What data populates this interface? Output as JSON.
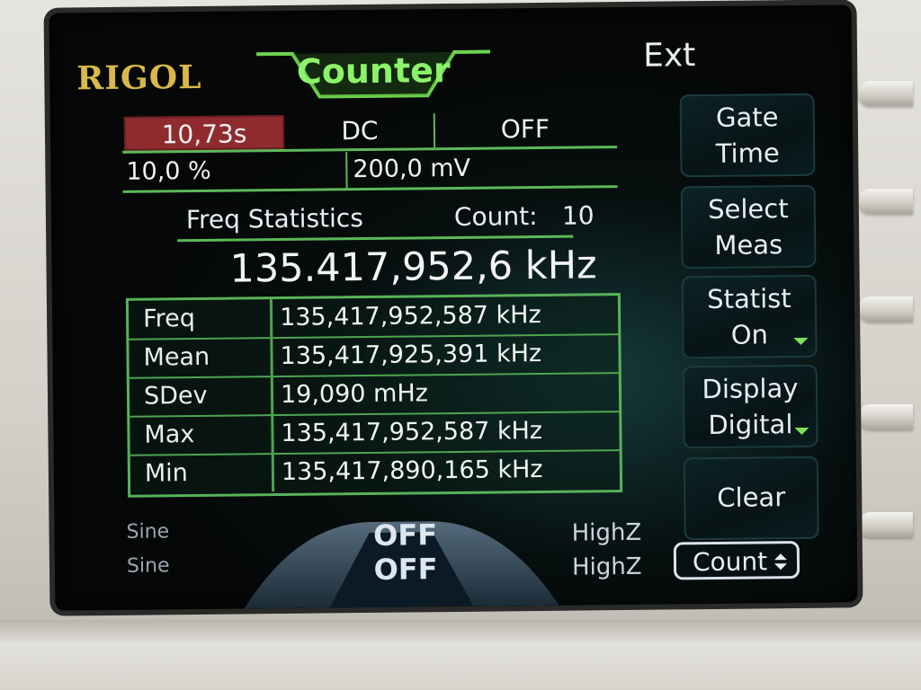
{
  "header": {
    "brand": "RIGOL",
    "title": "Counter",
    "trigger_source": "Ext"
  },
  "settings": {
    "gate_time": "10,73s",
    "coupling": "DC",
    "hf_filter": "OFF",
    "sensitivity": "10,0 %",
    "trigger_level": "200,0 mV"
  },
  "statistics": {
    "title": "Freq Statistics",
    "count_label": "Count:",
    "count_value": "10",
    "main_reading": "135.417,952,6 kHz",
    "rows": [
      {
        "name": "Freq",
        "value": "135,417,952,587 kHz"
      },
      {
        "name": "Mean",
        "value": "135,417,925,391 kHz"
      },
      {
        "name": "SDev",
        "value": "19,090 mHz"
      },
      {
        "name": "Max",
        "value": "135,417,952,587 kHz"
      },
      {
        "name": "Min",
        "value": "135,417,890,165 kHz"
      }
    ]
  },
  "channels": [
    {
      "waveform": "Sine",
      "state": "OFF",
      "impedance": "HighZ"
    },
    {
      "waveform": "Sine",
      "state": "OFF",
      "impedance": "HighZ"
    }
  ],
  "softkeys": {
    "gate_time": [
      "Gate",
      "Time"
    ],
    "select_meas": [
      "Select",
      "Meas"
    ],
    "statist": [
      "Statist",
      "On"
    ],
    "display": [
      "Display",
      "Digital"
    ],
    "clear": "Clear",
    "count_tab": "Count"
  },
  "colors": {
    "accent_green": "#8cf26a",
    "brand_gold": "#d9b84a",
    "gate_highlight": "#8f2b2f",
    "grid_green": "#58b25a"
  },
  "icons": [
    "arrow-down-icon",
    "updown-arrow-icon"
  ]
}
